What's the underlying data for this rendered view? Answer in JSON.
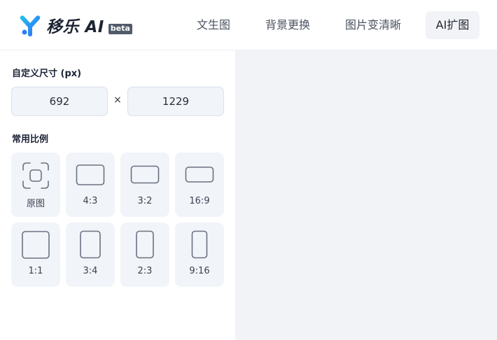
{
  "header": {
    "brand": "移乐 AI",
    "badge": "beta",
    "nav": [
      {
        "label": "文生图",
        "active": false
      },
      {
        "label": "背景更换",
        "active": false
      },
      {
        "label": "图片变清晰",
        "active": false
      },
      {
        "label": "AI扩图",
        "active": true
      }
    ]
  },
  "sidebar": {
    "custom_size_title": "自定义尺寸 (px)",
    "width_value": "692",
    "separator": "×",
    "height_value": "1229",
    "ratios_title": "常用比例",
    "ratios": [
      {
        "label": "原图",
        "icon": "original-frame-icon"
      },
      {
        "label": "4:3",
        "icon": "ratio-4-3-icon"
      },
      {
        "label": "3:2",
        "icon": "ratio-3-2-icon"
      },
      {
        "label": "16:9",
        "icon": "ratio-16-9-icon"
      },
      {
        "label": "1:1",
        "icon": "ratio-1-1-icon"
      },
      {
        "label": "3:4",
        "icon": "ratio-3-4-icon"
      },
      {
        "label": "2:3",
        "icon": "ratio-2-3-icon"
      },
      {
        "label": "9:16",
        "icon": "ratio-9-16-icon"
      }
    ]
  },
  "colors": {
    "logo_blue": "#2f7cf6",
    "logo_cyan": "#22c3f0",
    "card_bg": "#f1f4f9",
    "canvas_bg": "#f2f3f6"
  }
}
